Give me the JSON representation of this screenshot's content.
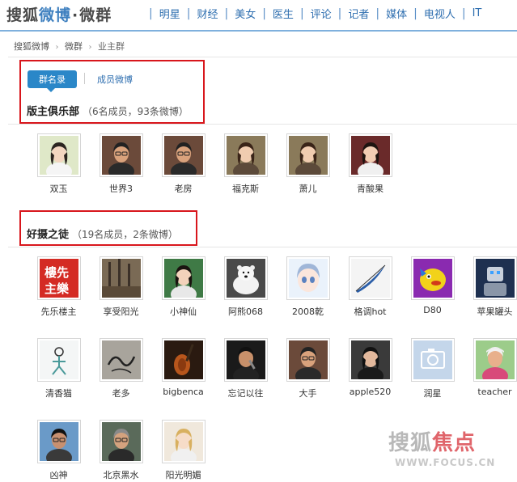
{
  "header": {
    "logo_sohu": "搜狐",
    "logo_weibo": "微博",
    "logo_dot": "·",
    "logo_qun": "微群",
    "nav": [
      "明星",
      "财经",
      "美女",
      "医生",
      "评论",
      "记者",
      "媒体",
      "电视人",
      "IT"
    ]
  },
  "breadcrumb": [
    "搜狐微博",
    "微群",
    "业主群"
  ],
  "breadcrumb_separator": "›",
  "tabs": {
    "active": "群名录",
    "inactive": "成员微博"
  },
  "sections": [
    {
      "name": "版主俱乐部",
      "stats": "（6名成员，93条微博）",
      "members": [
        {
          "name": "双玉",
          "icon": "avatar-woman-outdoor"
        },
        {
          "name": "世界3",
          "icon": "avatar-man-glasses"
        },
        {
          "name": "老房",
          "icon": "avatar-man-glasses"
        },
        {
          "name": "福克斯",
          "icon": "avatar-woman"
        },
        {
          "name": "萧儿",
          "icon": "avatar-woman"
        },
        {
          "name": "青酸果",
          "icon": "avatar-woman-red"
        }
      ]
    },
    {
      "name": "好摄之徒",
      "stats": "（19名成员，2条微博）",
      "members": [
        {
          "name": "先乐楼主",
          "icon": "avatar-red-calligraphy"
        },
        {
          "name": "享受阳光",
          "icon": "avatar-forest"
        },
        {
          "name": "小神仙",
          "icon": "avatar-girl"
        },
        {
          "name": "阿熊068",
          "icon": "avatar-polar-bear"
        },
        {
          "name": "2008乾",
          "icon": "avatar-anime-girl"
        },
        {
          "name": "格调hot",
          "icon": "avatar-feather"
        },
        {
          "name": "D80",
          "icon": "avatar-cartoon-dog"
        },
        {
          "name": "苹果罐头",
          "icon": "avatar-robot"
        },
        {
          "name": "清香猫",
          "icon": "avatar-sketch"
        },
        {
          "name": "老多",
          "icon": "avatar-scribble"
        },
        {
          "name": "bigbenca",
          "icon": "avatar-violin"
        },
        {
          "name": "忘记以往",
          "icon": "avatar-singer"
        },
        {
          "name": "大手",
          "icon": "avatar-man-glasses"
        },
        {
          "name": "apple520",
          "icon": "avatar-woman-dark"
        },
        {
          "name": "润星",
          "icon": "avatar-default-camera"
        },
        {
          "name": "teacher",
          "icon": "avatar-man-hat"
        },
        {
          "name": "凶神",
          "icon": "avatar-man-sea"
        },
        {
          "name": "北京黑水",
          "icon": "avatar-old-man"
        },
        {
          "name": "阳光明媚",
          "icon": "avatar-blonde-girl"
        }
      ]
    }
  ],
  "watermark": {
    "text_gray": "搜狐",
    "text_red": "焦点",
    "url": "WWW.FOCUS.CN"
  },
  "colors": {
    "accent": "#2a87c8",
    "link": "#2f6fb0",
    "highlight_box": "#d8161c"
  }
}
